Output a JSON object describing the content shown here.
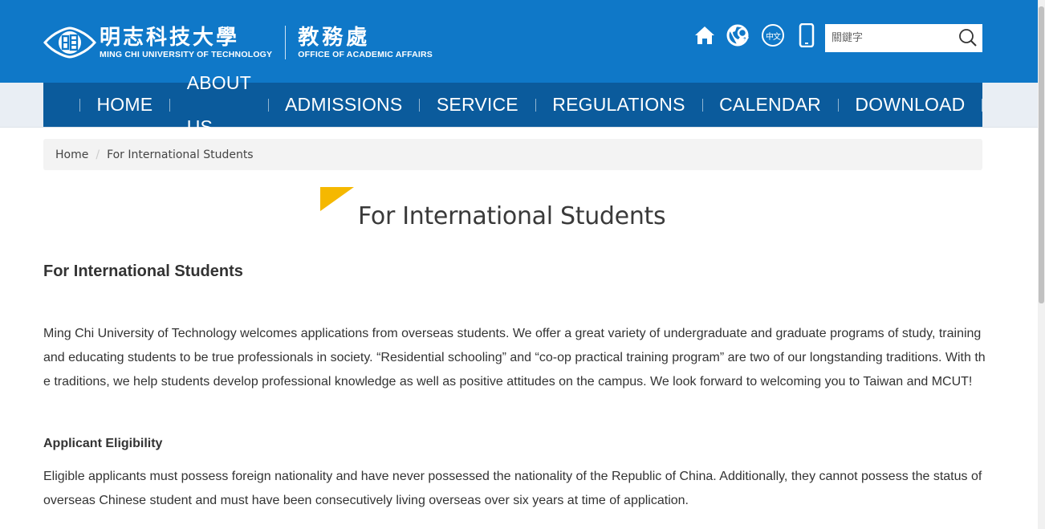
{
  "header": {
    "univ_zh": "明志科技大學",
    "univ_en": "MING CHI UNIVERSITY OF TECHNOLOGY",
    "dept_zh": "教務處",
    "dept_en": "OFFICE OF ACADEMIC AFFAIRS",
    "tools": {
      "home_icon": "home-icon",
      "contact_icon": "phone-chat-icon",
      "lang_label": "中文",
      "mobile_icon": "mobile-icon"
    },
    "search": {
      "placeholder": "關鍵字",
      "button_icon": "search-icon"
    },
    "colors": {
      "header_bg": "#0f78c8",
      "nav_bg": "#0b5b9c",
      "accent": "#f5b800"
    }
  },
  "nav": {
    "items": [
      {
        "label": "HOME"
      },
      {
        "label": "ABOUT US"
      },
      {
        "label": "ADMISSIONS"
      },
      {
        "label": "SERVICE"
      },
      {
        "label": "REGULATIONS"
      },
      {
        "label": "CALENDAR"
      },
      {
        "label": "DOWNLOAD"
      }
    ]
  },
  "breadcrumb": {
    "home": "Home",
    "current": "For International Students"
  },
  "main": {
    "page_title": "For International Students",
    "heading": "For International Students",
    "intro": "Ming Chi University of Technology welcomes applications from overseas students. We offer a great variety of undergraduate and graduate programs of study, training and educating students to be true professionals in society. “Residential schooling” and “co-op practical training program” are two of our longstanding traditions. With the traditions, we help students develop professional knowledge as well as positive attitudes on the campus. We look forward to welcoming you to Taiwan and MCUT!",
    "eligibility_heading": "Applicant Eligibility",
    "eligibility_text": "Eligible applicants must possess foreign nationality and have never possessed the nationality of the Republic of China. Additionally, they cannot possess the status of overseas Chinese student and must have been consecutively living overseas over six years at time of application."
  }
}
